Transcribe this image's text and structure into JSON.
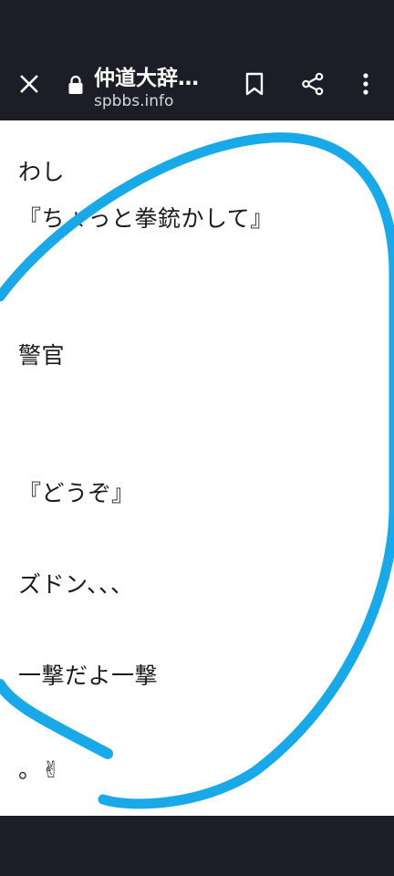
{
  "toolbar": {
    "close_icon": "close-icon",
    "lock_icon": "lock-icon",
    "page_title": "仲道大辞…",
    "url": "spbbs.info",
    "bookmark_icon": "bookmark-icon",
    "share_icon": "share-icon",
    "more_icon": "more-vert-icon"
  },
  "content": {
    "lines": [
      "わし",
      "『ちょっと拳銃かして』",
      "警官",
      "『どうぞ』",
      "ズドン、、、",
      "一撃だよ一撃",
      "。✌"
    ]
  },
  "annotation": {
    "color": "#1aa9e8"
  },
  "colors": {
    "chrome": "#1c1d26",
    "page": "#ffffff",
    "text": "#1b1b1b"
  }
}
